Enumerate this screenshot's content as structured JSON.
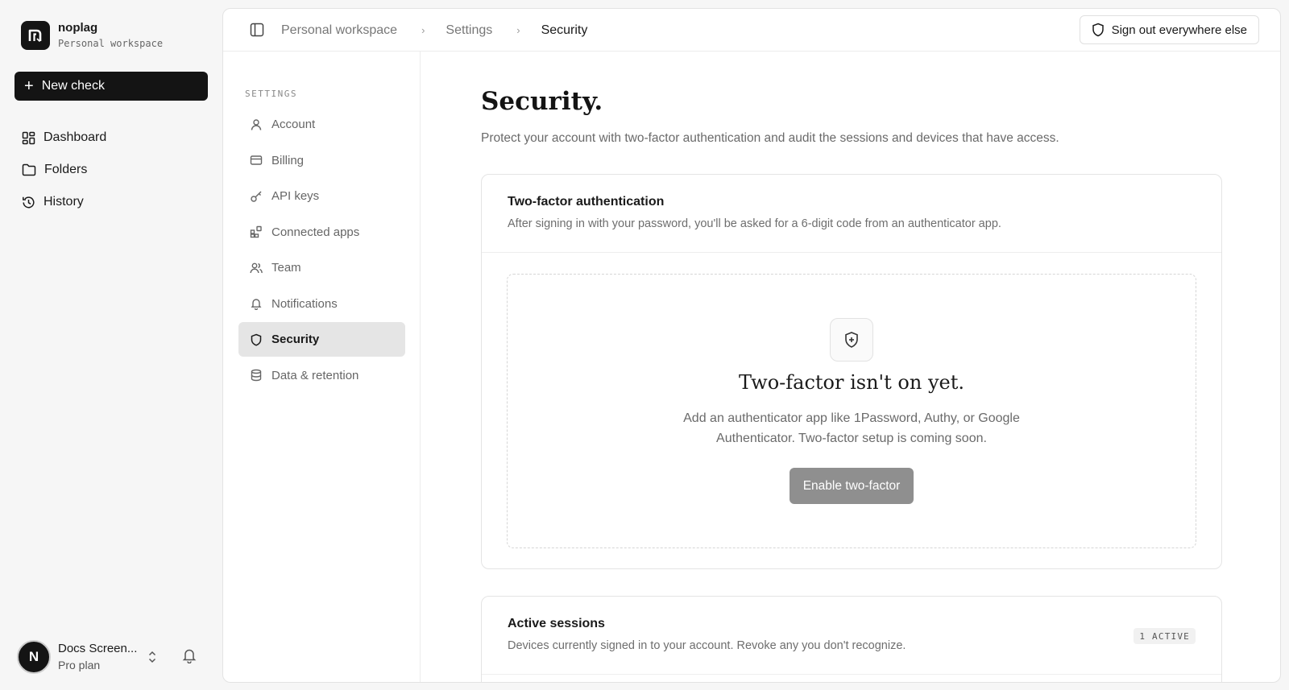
{
  "app": {
    "brand_name": "noplag",
    "workspace_label": "Personal workspace",
    "new_check_label": "New check"
  },
  "nav": {
    "items": [
      {
        "label": "Dashboard",
        "icon": "grid-icon"
      },
      {
        "label": "Folders",
        "icon": "folder-icon"
      },
      {
        "label": "History",
        "icon": "history-icon"
      }
    ]
  },
  "user": {
    "initial": "N",
    "name": "Docs Screen...",
    "plan": "Pro plan"
  },
  "breadcrumb": {
    "items": [
      "Personal workspace",
      "Settings",
      "Security"
    ]
  },
  "topbar": {
    "signout_label": "Sign out everywhere else"
  },
  "settings_nav": {
    "heading": "SETTINGS",
    "items": [
      {
        "label": "Account",
        "icon": "user-icon"
      },
      {
        "label": "Billing",
        "icon": "credit-card-icon"
      },
      {
        "label": "API keys",
        "icon": "key-icon"
      },
      {
        "label": "Connected apps",
        "icon": "apps-icon"
      },
      {
        "label": "Team",
        "icon": "team-icon"
      },
      {
        "label": "Notifications",
        "icon": "bell-icon"
      },
      {
        "label": "Security",
        "icon": "shield-icon",
        "active": true
      },
      {
        "label": "Data & retention",
        "icon": "database-icon"
      }
    ]
  },
  "page": {
    "title": "Security.",
    "subtitle": "Protect your account with two-factor authentication and audit the sessions and devices that have access."
  },
  "two_factor": {
    "title": "Two-factor authentication",
    "description": "After signing in with your password, you'll be asked for a 6-digit code from an authenticator app.",
    "empty_title": "Two-factor isn't on yet.",
    "empty_description": "Add an authenticator app like 1Password, Authy, or Google Authenticator. Two-factor setup is coming soon.",
    "enable_label": "Enable two-factor"
  },
  "sessions": {
    "title": "Active sessions",
    "description": "Devices currently signed in to your account. Revoke any you don't recognize.",
    "badge": "1 ACTIVE"
  },
  "colors": {
    "primary_dark": "#141414",
    "active_nav_bg": "#e5e5e5",
    "disabled_button": "#8f8f8f"
  }
}
